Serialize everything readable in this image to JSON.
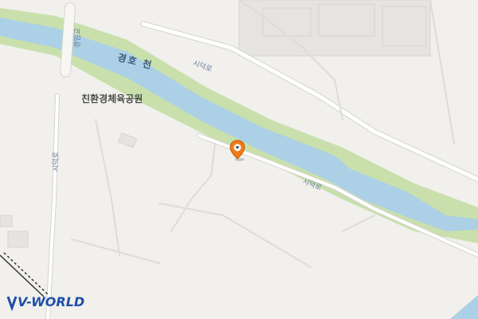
{
  "map": {
    "labels": {
      "river": "경호 천",
      "park": "친환경체육공원",
      "road_north": "시덕로",
      "road_south": "시덕로",
      "road_west": "시덕로",
      "bridge": "경임교"
    },
    "marker": {
      "icon": "location-pin-icon",
      "color": "#f07a1a"
    },
    "logo": {
      "text": "V-WORLD",
      "color": "#1f4ea8"
    },
    "colors": {
      "land": "#f1f0ed",
      "river": "#acd0e6",
      "riverbank": "#c9e0ac",
      "road": "#ffffff",
      "road_outline": "#d5d3cf"
    }
  }
}
